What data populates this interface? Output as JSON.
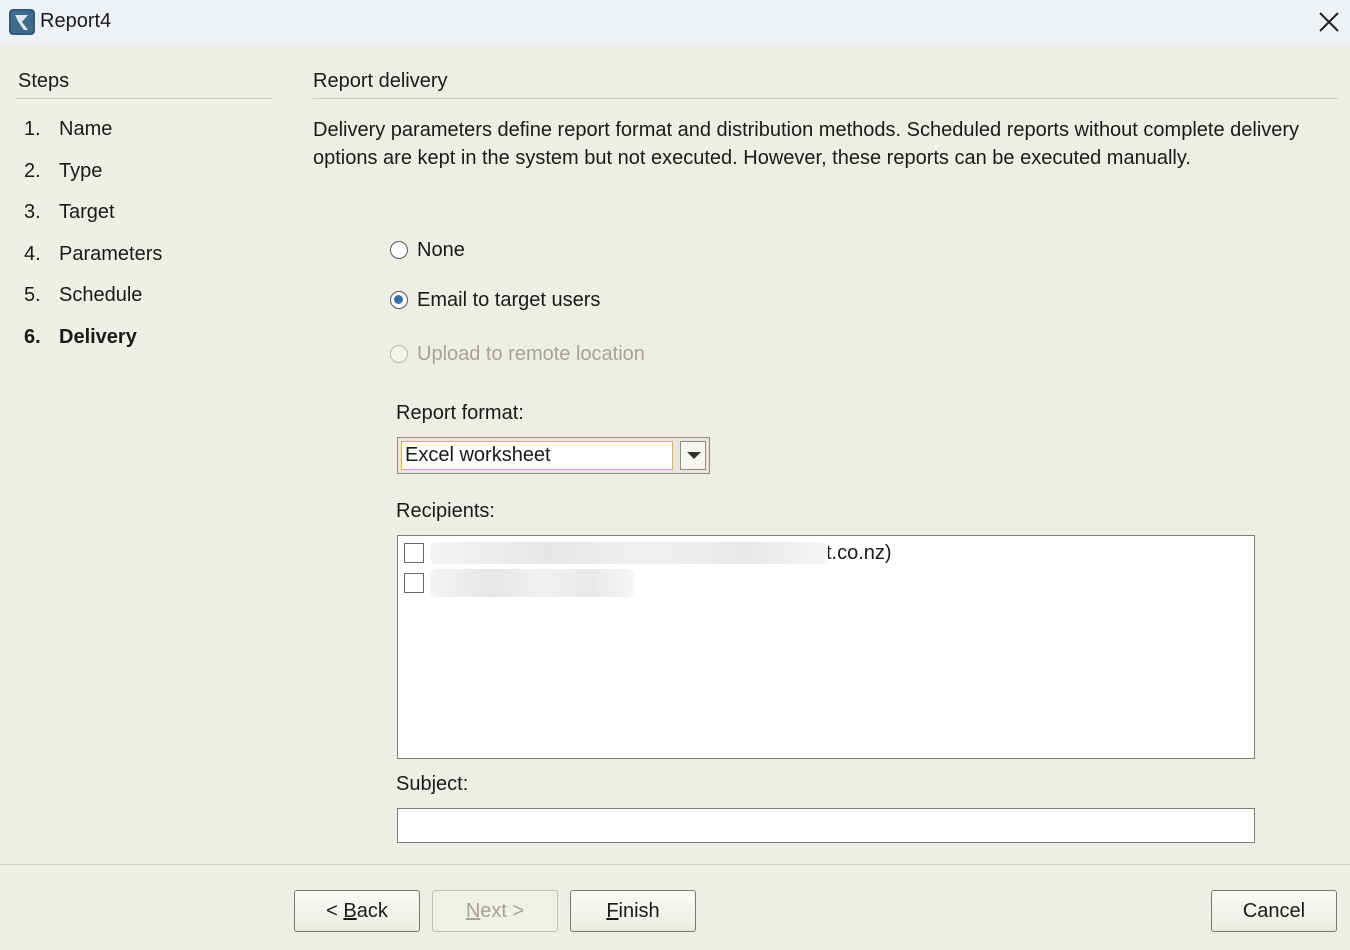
{
  "window": {
    "title": "Report4",
    "icon": "app-logo-icon",
    "close_icon": "close-icon"
  },
  "steps": {
    "heading": "Steps",
    "items": [
      {
        "num": "1.",
        "label": "Name",
        "active": false
      },
      {
        "num": "2.",
        "label": "Type",
        "active": false
      },
      {
        "num": "3.",
        "label": "Target",
        "active": false
      },
      {
        "num": "4.",
        "label": "Parameters",
        "active": false
      },
      {
        "num": "5.",
        "label": "Schedule",
        "active": false
      },
      {
        "num": "6.",
        "label": "Delivery",
        "active": true
      }
    ]
  },
  "content": {
    "title": "Report delivery",
    "description": "Delivery parameters define report format and distribution methods. Scheduled reports without complete delivery options are kept in the system but not executed. However, these reports can be executed manually.",
    "options": [
      {
        "label": "None",
        "checked": false,
        "disabled": false
      },
      {
        "label": "Email to target users",
        "checked": true,
        "disabled": false
      },
      {
        "label": "Upload to remote location",
        "checked": false,
        "disabled": true
      }
    ],
    "report_format": {
      "label": "Report format:",
      "value": "Excel worksheet"
    },
    "recipients": {
      "label": "Recipients:",
      "items": [
        {
          "visible_text": "t.co.nz)",
          "checked": false
        },
        {
          "visible_text": "",
          "checked": false
        }
      ]
    },
    "subject": {
      "label": "Subject:",
      "value": ""
    }
  },
  "buttons": {
    "back": {
      "prefix": "< ",
      "mnemonic": "B",
      "rest": "ack",
      "disabled": false
    },
    "next": {
      "label": "Next >",
      "mnemonic": "N",
      "rest": "ext >",
      "disabled": true
    },
    "finish": {
      "mnemonic": "F",
      "rest": "inish",
      "disabled": false
    },
    "cancel": {
      "label": "Cancel",
      "disabled": false
    }
  },
  "colors": {
    "accent": "#3b6ea5",
    "focus": "#e3b24a",
    "disabled_text": "#a6a496"
  }
}
